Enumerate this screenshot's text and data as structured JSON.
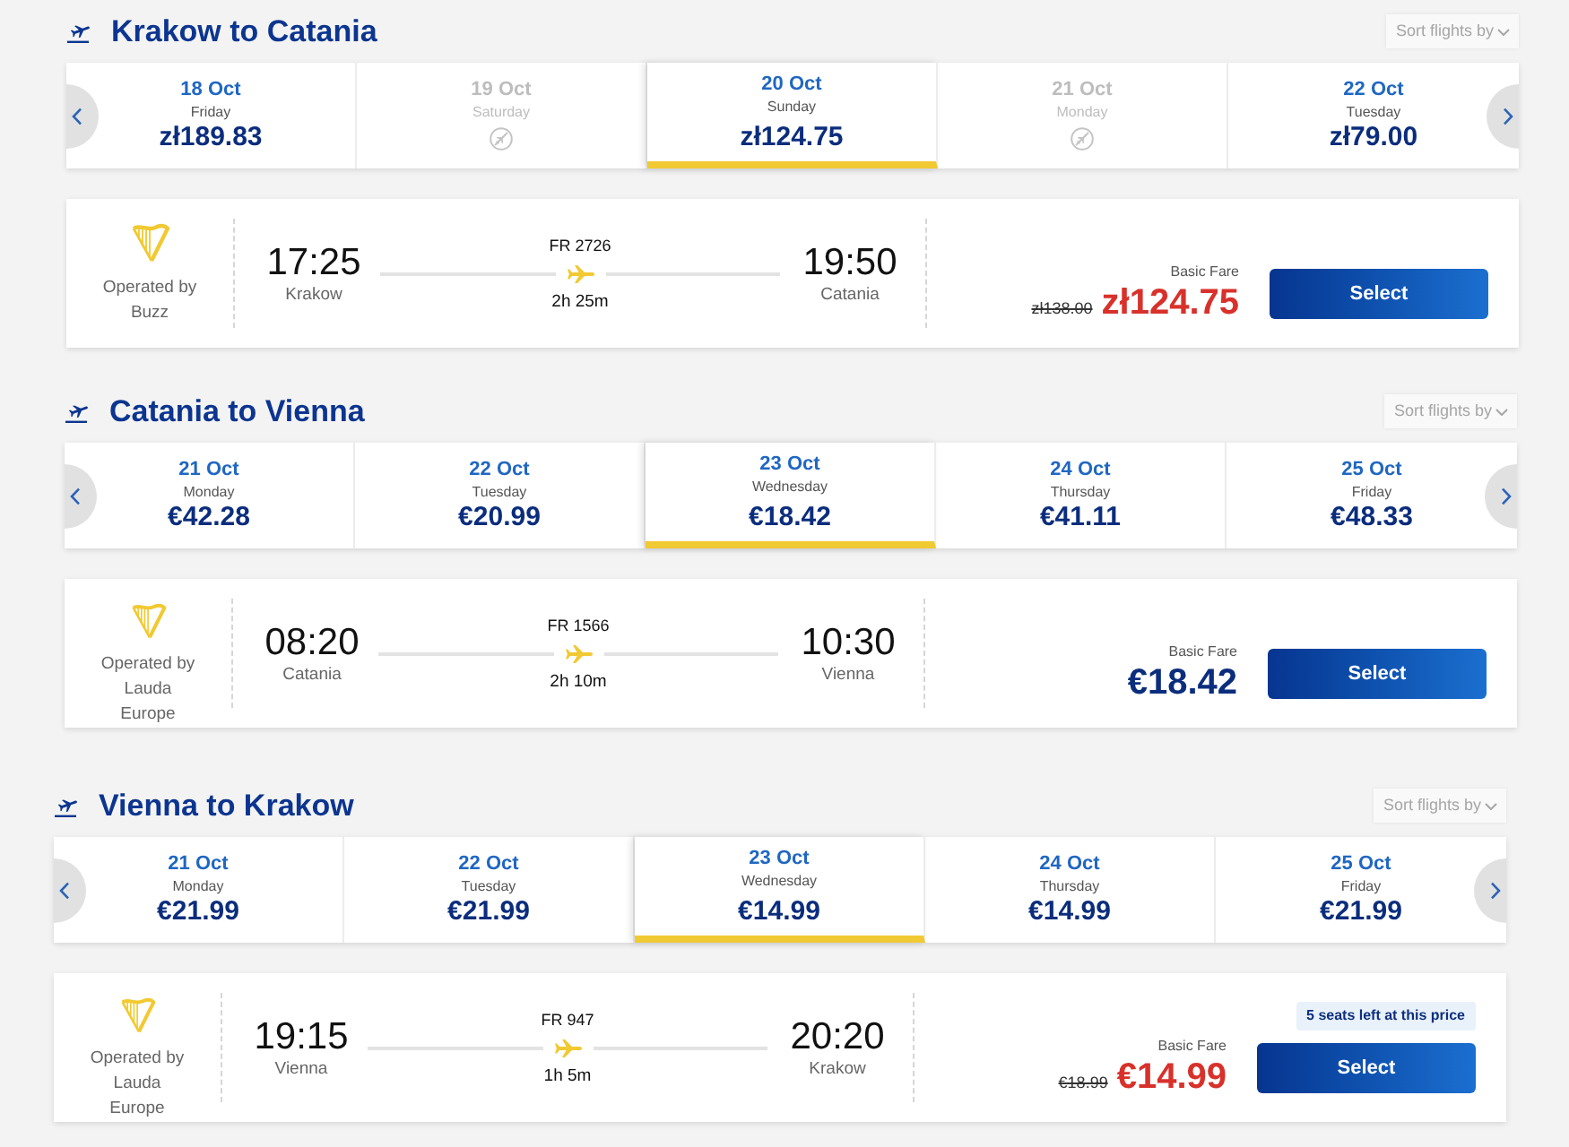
{
  "routes": [
    {
      "title": "Krakow to Catania",
      "sort_label": "Sort flights by",
      "dates": [
        {
          "date": "18 Oct",
          "weekday": "Friday",
          "price": "zł189.83",
          "available": true,
          "selected": false
        },
        {
          "date": "19 Oct",
          "weekday": "Saturday",
          "available": false,
          "selected": false
        },
        {
          "date": "20 Oct",
          "weekday": "Sunday",
          "price": "zł124.75",
          "available": true,
          "selected": true
        },
        {
          "date": "21 Oct",
          "weekday": "Monday",
          "available": false,
          "selected": false
        },
        {
          "date": "22 Oct",
          "weekday": "Tuesday",
          "price": "zł79.00",
          "available": true,
          "selected": false
        }
      ],
      "flight": {
        "operated_by": "Operated by",
        "operator": "Buzz",
        "departure_time": "17:25",
        "departure_city": "Krakow",
        "flight_number": "FR 2726",
        "duration": "2h 25m",
        "arrival_time": "19:50",
        "arrival_city": "Catania",
        "fare_label": "Basic Fare",
        "old_price": "zł138.00",
        "price": "zł124.75",
        "sale": true,
        "button": "Select"
      }
    },
    {
      "title": "Catania to Vienna",
      "sort_label": "Sort flights by",
      "dates": [
        {
          "date": "21 Oct",
          "weekday": "Monday",
          "price": "€42.28",
          "available": true,
          "selected": false
        },
        {
          "date": "22 Oct",
          "weekday": "Tuesday",
          "price": "€20.99",
          "available": true,
          "selected": false
        },
        {
          "date": "23 Oct",
          "weekday": "Wednesday",
          "price": "€18.42",
          "available": true,
          "selected": true
        },
        {
          "date": "24 Oct",
          "weekday": "Thursday",
          "price": "€41.11",
          "available": true,
          "selected": false
        },
        {
          "date": "25 Oct",
          "weekday": "Friday",
          "price": "€48.33",
          "available": true,
          "selected": false
        }
      ],
      "flight": {
        "operated_by": "Operated by",
        "operator": "Lauda Europe",
        "departure_time": "08:20",
        "departure_city": "Catania",
        "flight_number": "FR 1566",
        "duration": "2h 10m",
        "arrival_time": "10:30",
        "arrival_city": "Vienna",
        "fare_label": "Basic Fare",
        "price": "€18.42",
        "sale": false,
        "button": "Select"
      }
    },
    {
      "title": "Vienna to Krakow",
      "sort_label": "Sort flights by",
      "dates": [
        {
          "date": "21 Oct",
          "weekday": "Monday",
          "price": "€21.99",
          "available": true,
          "selected": false
        },
        {
          "date": "22 Oct",
          "weekday": "Tuesday",
          "price": "€21.99",
          "available": true,
          "selected": false
        },
        {
          "date": "23 Oct",
          "weekday": "Wednesday",
          "price": "€14.99",
          "available": true,
          "selected": true
        },
        {
          "date": "24 Oct",
          "weekday": "Thursday",
          "price": "€14.99",
          "available": true,
          "selected": false
        },
        {
          "date": "25 Oct",
          "weekday": "Friday",
          "price": "€21.99",
          "available": true,
          "selected": false
        }
      ],
      "flight": {
        "operated_by": "Operated by",
        "operator": "Lauda Europe",
        "departure_time": "19:15",
        "departure_city": "Vienna",
        "flight_number": "FR 947",
        "duration": "1h 5m",
        "arrival_time": "20:20",
        "arrival_city": "Krakow",
        "seats_badge": "5 seats left at this price",
        "fare_label": "Basic Fare",
        "old_price": "€18.99",
        "price": "€14.99",
        "sale": true,
        "button": "Select"
      }
    }
  ]
}
